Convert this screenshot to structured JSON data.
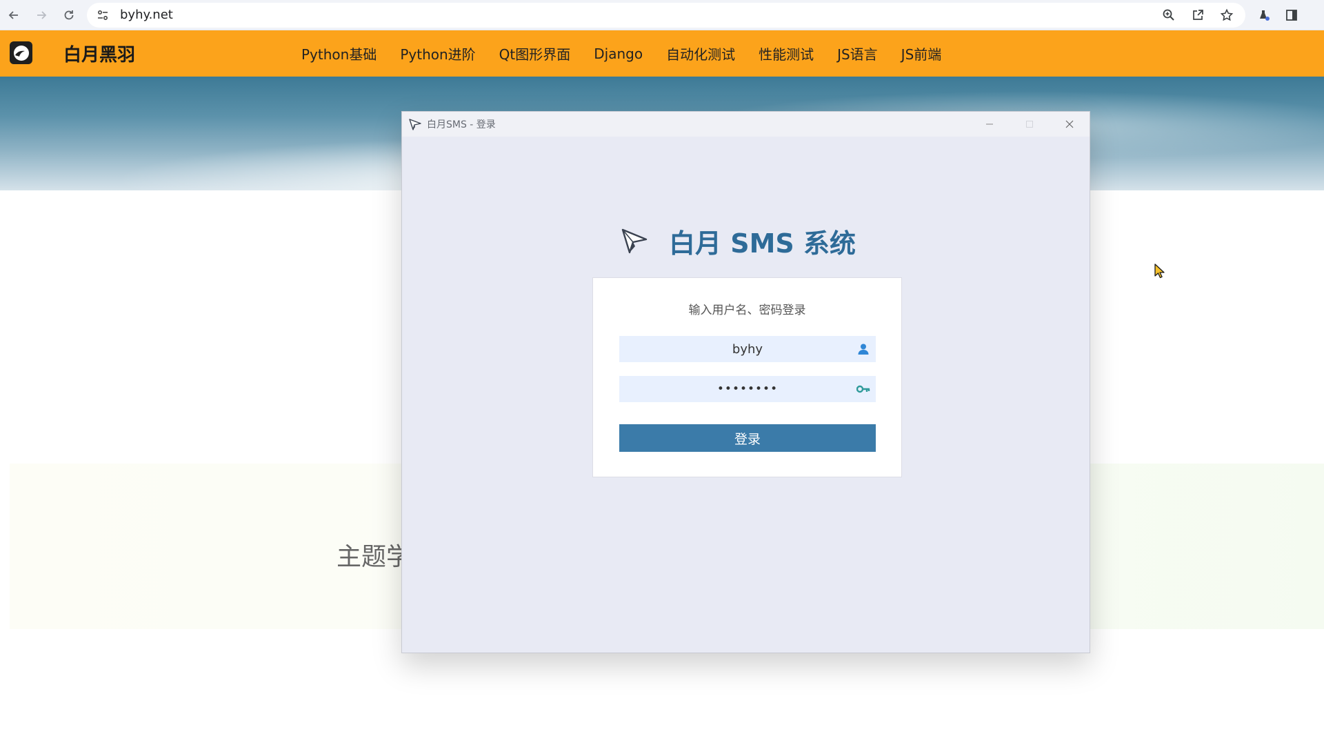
{
  "browser": {
    "url": "byhy.net",
    "icons": [
      "back-icon",
      "forward-icon",
      "reload-icon",
      "site-info-icon",
      "zoom-icon",
      "share-icon",
      "bookmark-star-icon",
      "extension-icon",
      "side-panel-icon"
    ]
  },
  "site": {
    "brand": "白月黑羽",
    "nav": [
      "Python基础",
      "Python进阶",
      "Qt图形界面",
      "Django",
      "自动化测试",
      "性能测试",
      "JS语言",
      "JS前端"
    ],
    "feature_heading": "主题学",
    "colors": {
      "header": "#fca31b"
    }
  },
  "dialog": {
    "title": "白月SMS - 登录",
    "heading": "白月 SMS 系统",
    "prompt": "输入用户名、密码登录",
    "username": "byhy",
    "password_mask": "••••••••",
    "login_label": "登录",
    "colors": {
      "accent": "#3b7ba9",
      "heading": "#2e6b98",
      "field_bg": "#e8f0fe"
    }
  }
}
